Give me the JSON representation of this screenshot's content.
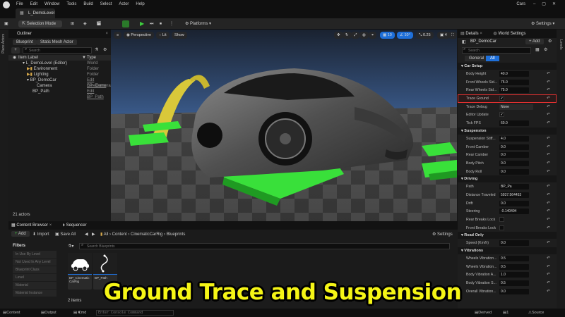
{
  "menubar": {
    "items": [
      "File",
      "Edit",
      "Window",
      "Tools",
      "Build",
      "Select",
      "Actor",
      "Help"
    ],
    "project": "Cars"
  },
  "level_tab": "L_DemoLevel",
  "toolbar": {
    "selection_mode": "Selection Mode",
    "platforms": "Platforms",
    "settings": "Settings"
  },
  "left_strip": "Place Actors",
  "right_strip": "Levels",
  "outliner": {
    "tab": "Outliner",
    "filter_blueprint": "Blueprint",
    "filter_static": "Static Mesh Actor",
    "search_placeholder": "Search",
    "col_label": "Item Label",
    "col_type": "Type",
    "rows": [
      {
        "label": "L_DemoLevel (Editor)",
        "type": "World"
      },
      {
        "label": "Environment",
        "type": "Folder"
      },
      {
        "label": "Lighting",
        "type": "Folder"
      },
      {
        "label": "BP_DemoCar",
        "type": "Edit BP_Demo"
      },
      {
        "label": "Camera",
        "type": "CineCameraA"
      },
      {
        "label": "BP_Path",
        "type": "Edit BP_Path"
      }
    ],
    "footer": "21 actors"
  },
  "viewport": {
    "perspective": "Perspective",
    "lit": "Lit",
    "show": "Show",
    "grid_snap": "10",
    "rot_snap": "10°",
    "scale_snap": "0.25",
    "cam_speed": "4"
  },
  "details": {
    "tab": "Details",
    "tab2": "World Settings",
    "actor": "BP_DemoCar",
    "add": "Add",
    "search_placeholder": "Search",
    "filter_general": "General",
    "filter_all": "All",
    "sections": [
      {
        "title": "Car Setup",
        "props": [
          {
            "label": "Body Height",
            "value": "40.0",
            "kind": "num"
          },
          {
            "label": "Front Wheels Sid...",
            "value": "75.0",
            "kind": "num"
          },
          {
            "label": "Rear Wheels Sid...",
            "value": "75.0",
            "kind": "num"
          },
          {
            "label": "Trace Ground",
            "value": "✓",
            "kind": "check",
            "highlight": true
          },
          {
            "label": "Trace Debug",
            "value": "None",
            "kind": "enum"
          },
          {
            "label": "Editor Update",
            "value": "✓",
            "kind": "check"
          },
          {
            "label": "Tick FPS",
            "value": "60.0",
            "kind": "num"
          }
        ]
      },
      {
        "title": "Suspension",
        "props": [
          {
            "label": "Suspension Stiff...",
            "value": "4.0",
            "kind": "num"
          },
          {
            "label": "Front Camber",
            "value": "0.0",
            "kind": "num"
          },
          {
            "label": "Rear Camber",
            "value": "0.0",
            "kind": "num"
          },
          {
            "label": "Body Pitch",
            "value": "0.0",
            "kind": "num"
          },
          {
            "label": "Body Roll",
            "value": "0.0",
            "kind": "num"
          }
        ]
      },
      {
        "title": "Driving",
        "props": [
          {
            "label": "Path",
            "value": "BP_Pa",
            "kind": "num"
          },
          {
            "label": "Distance Traveled",
            "value": "5937.564453",
            "kind": "num"
          },
          {
            "label": "Drift",
            "value": "0.0",
            "kind": "num"
          },
          {
            "label": "Steering",
            "value": "-0.140494",
            "kind": "num"
          },
          {
            "label": "Rear Breaks Lock",
            "value": "",
            "kind": "check"
          },
          {
            "label": "Front Breaks Lock",
            "value": "",
            "kind": "check"
          }
        ]
      },
      {
        "title": "Road Only",
        "props": [
          {
            "label": "Speed (Km/h)",
            "value": "0.0",
            "kind": "num"
          }
        ]
      },
      {
        "title": "Vibrations",
        "props": [
          {
            "label": "Wheels Vibration...",
            "value": "0.5",
            "kind": "num"
          },
          {
            "label": "Wheels Vibration...",
            "value": "0.5",
            "kind": "num"
          },
          {
            "label": "Body Vibration A...",
            "value": "1.0",
            "kind": "num"
          },
          {
            "label": "Body Vibration S...",
            "value": "0.5",
            "kind": "num"
          },
          {
            "label": "Overall Vibration...",
            "value": "0.0",
            "kind": "num"
          }
        ]
      }
    ]
  },
  "content_browser": {
    "tab": "Content Browser",
    "tab2": "Sequencer",
    "add": "Add",
    "import": "Import",
    "save_all": "Save All",
    "breadcrumb": [
      "All",
      "Content",
      "CinematicCarRig",
      "Blueprints"
    ],
    "settings": "Settings",
    "filters_title": "Filters",
    "search_placeholder": "Search Blueprints",
    "filters": [
      "In Use By Level",
      "Not Used In Any Level",
      "Blueprint Class",
      "Level",
      "Material",
      "Material Instance"
    ],
    "assets": [
      {
        "name": "BP_Cinematic CarRig"
      },
      {
        "name": "BP_Path"
      }
    ],
    "count": "2 items"
  },
  "statusbar": {
    "content_drawer": "Content Drawer",
    "output_log": "Output Log",
    "cmd": "Cmd",
    "console_placeholder": "Enter Console Command",
    "derived_data": "Derived Data",
    "unsaved": "1 Unsaved",
    "source_control": "Source Control"
  },
  "overlay_title": "Ground Trace and Suspension",
  "colors": {
    "accent_blue": "#1e6fd9",
    "highlight_red": "#e03030",
    "title_yellow": "#f5f516",
    "ramp_green": "#39e03a"
  }
}
